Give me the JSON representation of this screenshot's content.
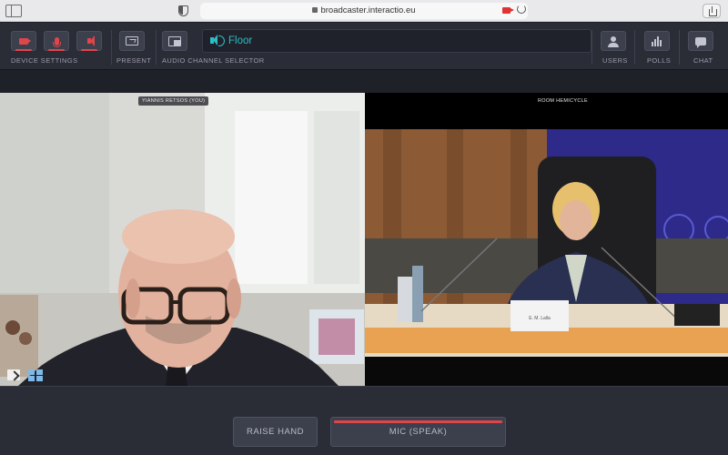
{
  "browser": {
    "url": "broadcaster.interactio.eu"
  },
  "toolbar": {
    "device_settings_label": "DEVICE SETTINGS",
    "present_label": "PRESENT",
    "audio_channel_label": "AUDIO CHANNEL SELECTOR",
    "selected_channel": "Floor",
    "users_label": "USERS",
    "polls_label": "POLLS",
    "chat_label": "CHAT",
    "active_color": "#e0454b",
    "channel_color": "#2dbdc4"
  },
  "videos": {
    "local_name": "YIANNIS RETSOS (YOU)",
    "remote_name": "ROOM HEMICYCLE",
    "nameplate": "E. M. Lalla"
  },
  "bottom": {
    "raise_hand_label": "RAISE HAND",
    "mic_label": "MIC (SPEAK)"
  }
}
